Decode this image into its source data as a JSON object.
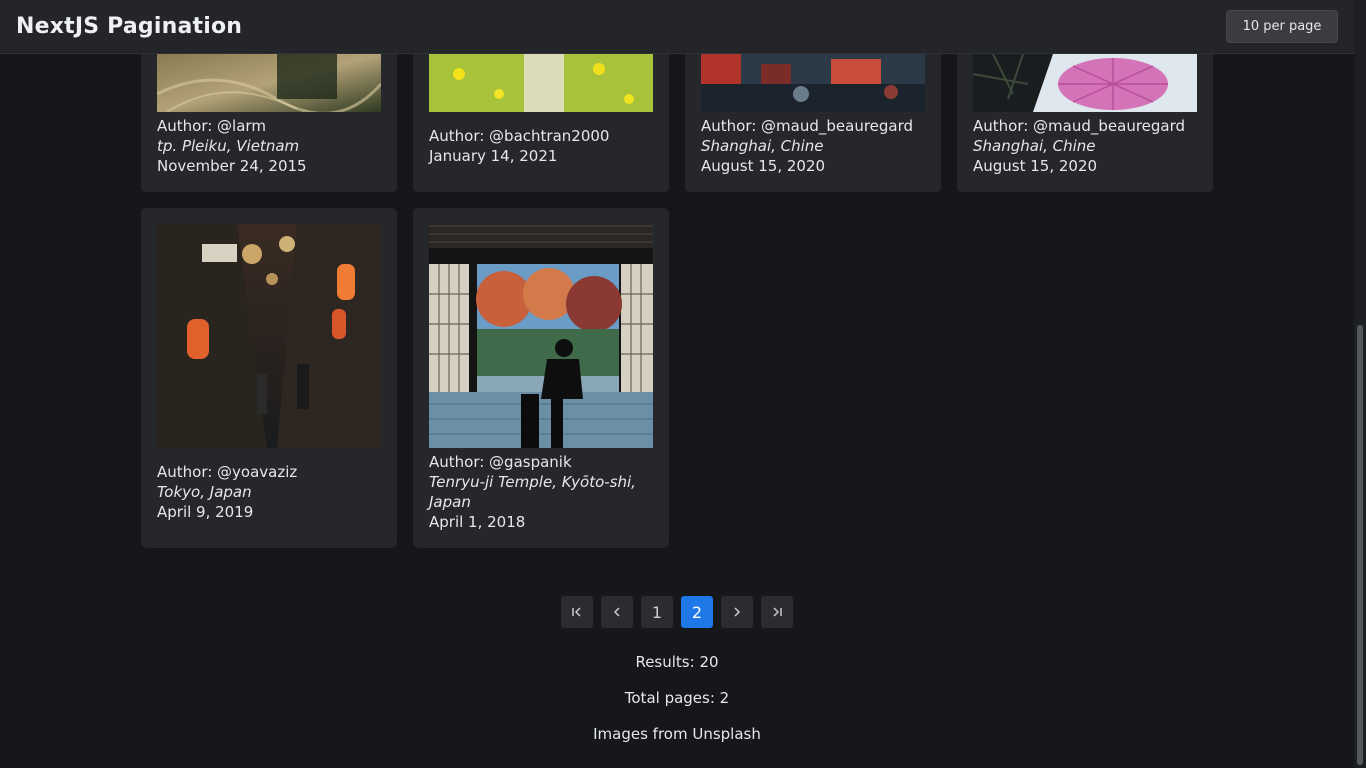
{
  "header": {
    "title": "NextJS Pagination",
    "per_page_label": "10 per page"
  },
  "cards": [
    {
      "author": "Author: @larm",
      "location": "tp. Pleiku, Vietnam",
      "date": "November 24, 2015"
    },
    {
      "author": "Author: @bachtran2000",
      "location": "",
      "date": "January 14, 2021"
    },
    {
      "author": "Author: @maud_beauregard",
      "location": "Shanghai, Chine",
      "date": "August 15, 2020"
    },
    {
      "author": "Author: @maud_beauregard",
      "location": "Shanghai, Chine",
      "date": "August 15, 2020"
    },
    {
      "author": "Author: @yoavaziz",
      "location": "Tokyo, Japan",
      "date": "April 9, 2019"
    },
    {
      "author": "Author: @gaspanik",
      "location": "Tenryu-ji Temple, Kyōto-shi, Japan",
      "date": "April 1, 2018"
    }
  ],
  "pagination": {
    "first_icon": "first-page-icon",
    "prev_icon": "chevron-left-icon",
    "pages": [
      "1",
      "2"
    ],
    "current_page": "2",
    "next_icon": "chevron-right-icon",
    "last_icon": "last-page-icon",
    "accent_color": "#1f78e8"
  },
  "footer": {
    "results": "Results: 20",
    "total_pages": "Total pages: 2",
    "credit": "Images from Unsplash"
  }
}
